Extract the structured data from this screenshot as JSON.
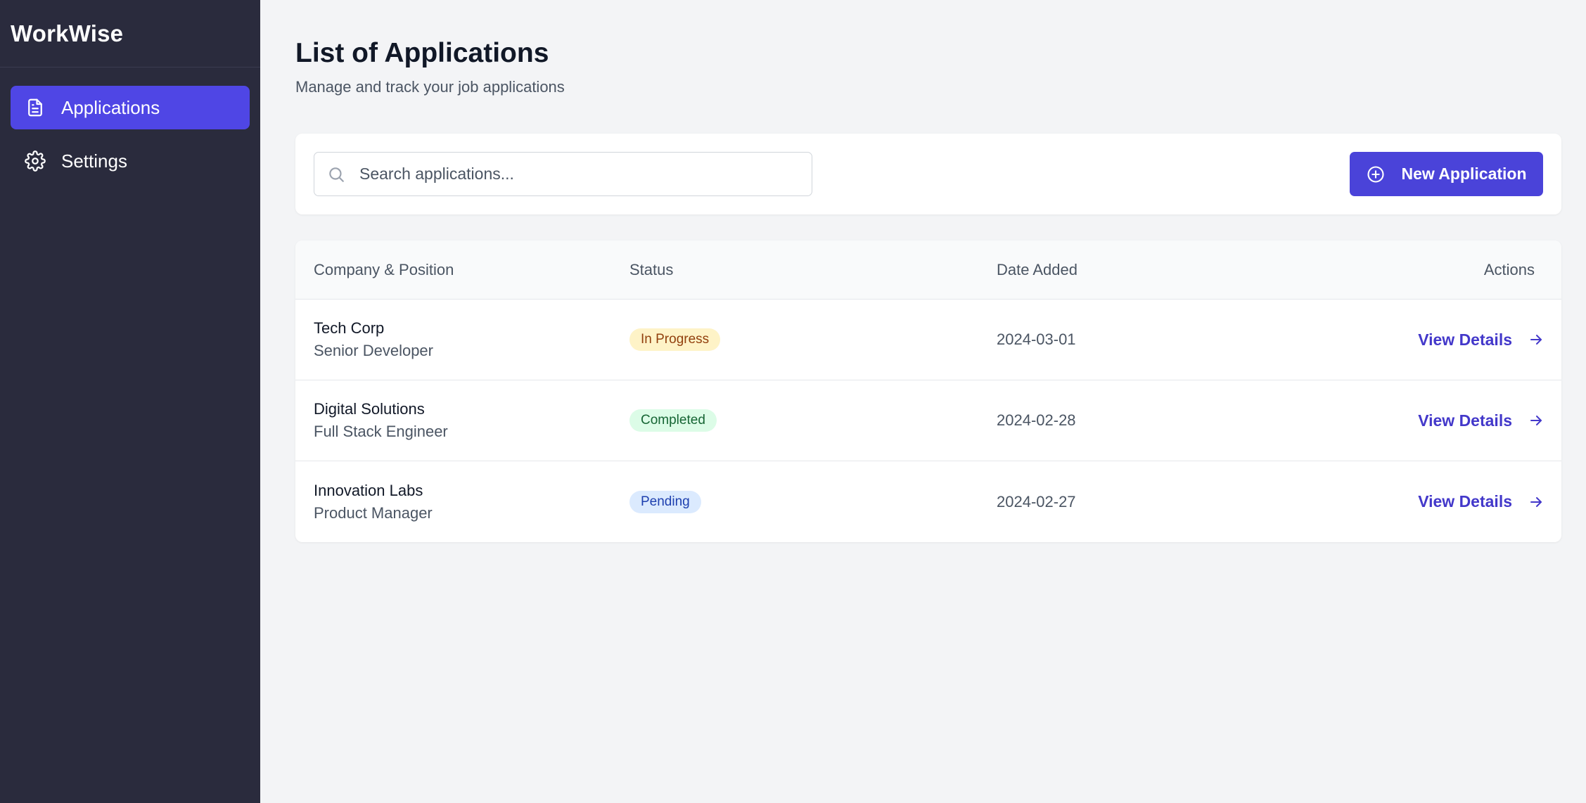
{
  "app": {
    "brand": "WorkWise"
  },
  "sidebar": {
    "items": [
      {
        "label": "Applications",
        "icon": "document-icon",
        "active": true
      },
      {
        "label": "Settings",
        "icon": "gear-icon",
        "active": false
      }
    ]
  },
  "header": {
    "title": "List of Applications",
    "subtitle": "Manage and track your job applications"
  },
  "toolbar": {
    "search_placeholder": "Search applications...",
    "new_button_label": "New Application"
  },
  "table": {
    "headers": {
      "company": "Company & Position",
      "status": "Status",
      "date": "Date Added",
      "actions": "Actions"
    },
    "rows": [
      {
        "company": "Tech Corp",
        "position": "Senior Developer",
        "status": "In Progress",
        "date": "2024-03-01",
        "action": "View Details"
      },
      {
        "company": "Digital Solutions",
        "position": "Full Stack Engineer",
        "status": "Completed",
        "date": "2024-02-28",
        "action": "View Details"
      },
      {
        "company": "Innovation Labs",
        "position": "Product Manager",
        "status": "Pending",
        "date": "2024-02-27",
        "action": "View Details"
      }
    ]
  },
  "colors": {
    "sidebar_bg": "#2a2b3d",
    "accent": "#4f46e5",
    "status_in_progress_bg": "#fef3c7",
    "status_in_progress_fg": "#92400e",
    "status_completed_bg": "#dcfce7",
    "status_completed_fg": "#166534",
    "status_pending_bg": "#dbeafe",
    "status_pending_fg": "#1e40af"
  }
}
